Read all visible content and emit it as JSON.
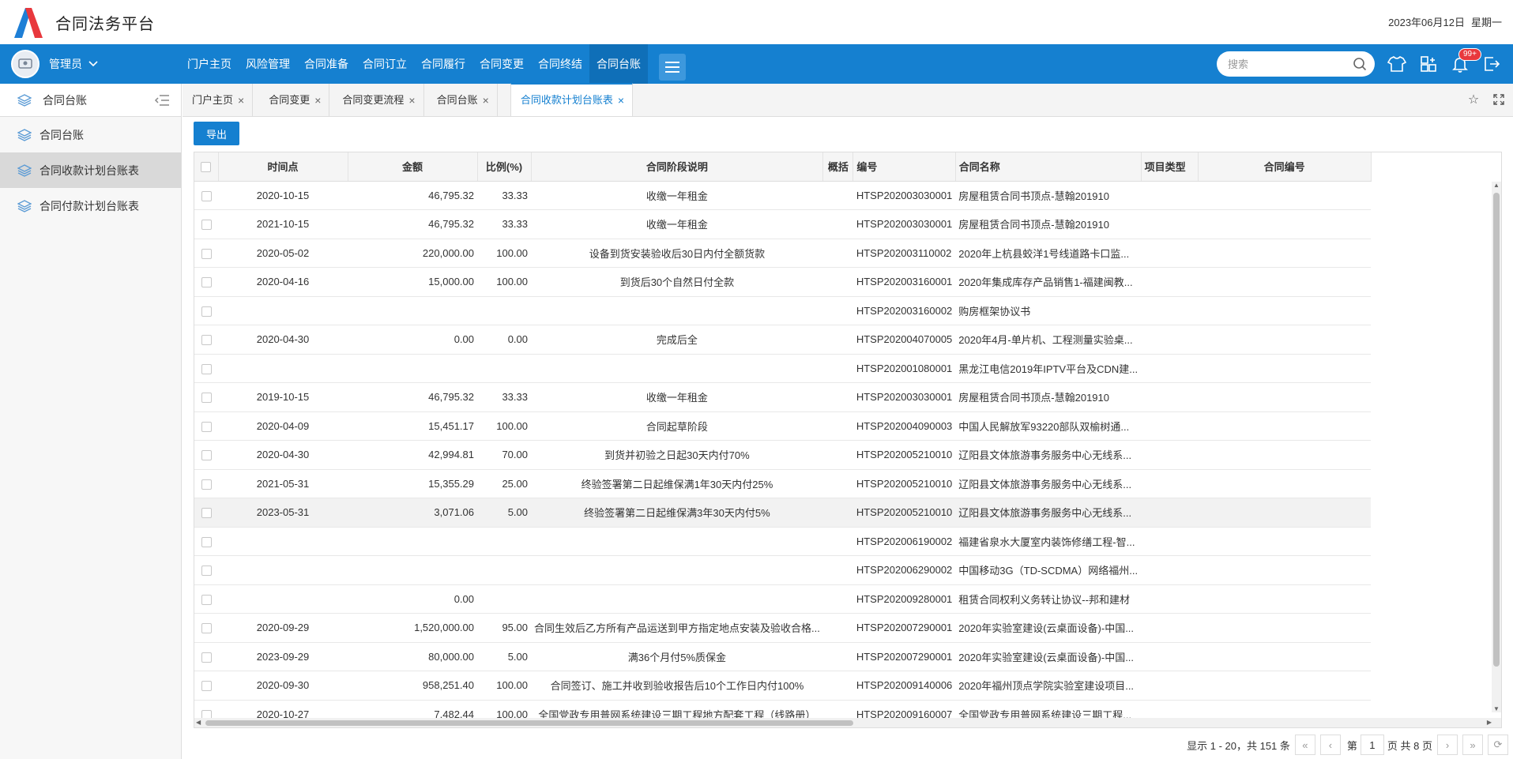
{
  "app": {
    "title": "合同法务平台",
    "date": "2023年06月12日",
    "weekday": "星期一"
  },
  "user": {
    "name": "管理员"
  },
  "nav": {
    "items": [
      "门户主页",
      "风险管理",
      "合同准备",
      "合同订立",
      "合同履行",
      "合同变更",
      "合同终结",
      "合同台账"
    ],
    "active": 7
  },
  "search": {
    "placeholder": "搜索"
  },
  "notifications": {
    "badge": "99+"
  },
  "sidebar": {
    "header": "合同台账",
    "items": [
      "合同台账",
      "合同收款计划台账表",
      "合同付款计划台账表"
    ],
    "active": 1
  },
  "tabs": [
    "门户主页",
    "合同变更",
    "合同变更流程",
    "合同台账",
    "合同收款计划台账表"
  ],
  "toolbar": {
    "export_label": "导出"
  },
  "table": {
    "columns": [
      "时间点",
      "金额",
      "比例(%)",
      "合同阶段说明",
      "概括",
      "编号",
      "合同名称",
      "项目类型",
      "合同编号"
    ],
    "rows": [
      [
        "2020-10-15",
        "46,795.32",
        "33.33",
        "收缴一年租金",
        "",
        "HTSP202003030001",
        "房屋租赁合同书顶点-慧翰201910",
        "",
        ""
      ],
      [
        "2021-10-15",
        "46,795.32",
        "33.33",
        "收缴一年租金",
        "",
        "HTSP202003030001",
        "房屋租赁合同书顶点-慧翰201910",
        "",
        ""
      ],
      [
        "2020-05-02",
        "220,000.00",
        "100.00",
        "设备到货安装验收后30日内付全额货款",
        "",
        "HTSP202003110002",
        "2020年上杭县蛟洋1号线道路卡口监...",
        "",
        ""
      ],
      [
        "2020-04-16",
        "15,000.00",
        "100.00",
        "到货后30个自然日付全款",
        "",
        "HTSP202003160001",
        "2020年集成库存产品销售1-福建闽教...",
        "",
        ""
      ],
      [
        "",
        "",
        "",
        "",
        "",
        "HTSP202003160002",
        "购房框架协议书",
        "",
        ""
      ],
      [
        "2020-04-30",
        "0.00",
        "0.00",
        "完成后全",
        "",
        "HTSP202004070005",
        "2020年4月-单片机、工程测量实验桌...",
        "",
        ""
      ],
      [
        "",
        "",
        "",
        "",
        "",
        "HTSP202001080001",
        "黑龙江电信2019年IPTV平台及CDN建...",
        "",
        ""
      ],
      [
        "2019-10-15",
        "46,795.32",
        "33.33",
        "收缴一年租金",
        "",
        "HTSP202003030001",
        "房屋租赁合同书顶点-慧翰201910",
        "",
        ""
      ],
      [
        "2020-04-09",
        "15,451.17",
        "100.00",
        "合同起草阶段",
        "",
        "HTSP202004090003",
        "中国人民解放军93220部队双榆树通...",
        "",
        ""
      ],
      [
        "2020-04-30",
        "42,994.81",
        "70.00",
        "到货并初验之日起30天内付70%",
        "",
        "HTSP202005210010",
        "辽阳县文体旅游事务服务中心无线系...",
        "",
        ""
      ],
      [
        "2021-05-31",
        "15,355.29",
        "25.00",
        "终验签署第二日起维保满1年30天内付25%",
        "",
        "HTSP202005210010",
        "辽阳县文体旅游事务服务中心无线系...",
        "",
        ""
      ],
      [
        "2023-05-31",
        "3,071.06",
        "5.00",
        "终验签署第二日起维保满3年30天内付5%",
        "",
        "HTSP202005210010",
        "辽阳县文体旅游事务服务中心无线系...",
        "",
        ""
      ],
      [
        "",
        "",
        "",
        "",
        "",
        "HTSP202006190002",
        "福建省泉水大厦室内装饰修缮工程-智...",
        "",
        ""
      ],
      [
        "",
        "",
        "",
        "",
        "",
        "HTSP202006290002",
        "中国移动3G（TD-SCDMA）网络福州...",
        "",
        ""
      ],
      [
        "",
        "0.00",
        "",
        "",
        "",
        "HTSP202009280001",
        "租赁合同权利义务转让协议--邦和建材",
        "",
        ""
      ],
      [
        "2020-09-29",
        "1,520,000.00",
        "95.00",
        "合同生效后乙方所有产品运送到甲方指定地点安装及验收合格...",
        "",
        "HTSP202007290001",
        "2020年实验室建设(云桌面设备)-中国...",
        "",
        ""
      ],
      [
        "2023-09-29",
        "80,000.00",
        "5.00",
        "满36个月付5%质保金",
        "",
        "HTSP202007290001",
        "2020年实验室建设(云桌面设备)-中国...",
        "",
        ""
      ],
      [
        "2020-09-30",
        "958,251.40",
        "100.00",
        "合同签订、施工并收到验收报告后10个工作日内付100%",
        "",
        "HTSP202009140006",
        "2020年福州顶点学院实验室建设项目...",
        "",
        ""
      ],
      [
        "2020-10-27",
        "7,482.44",
        "100.00",
        "全国党政专用普网系统建设三期工程地方配套工程（线路册）",
        "",
        "HTSP202009160007",
        "全国党政专用普网系统建设三期工程...",
        "",
        ""
      ]
    ],
    "highlighted_row": 11
  },
  "pager": {
    "summary": "显示 1 - 20，共 151 条",
    "page_prefix": "第",
    "current_page": "1",
    "page_suffix": "页 共 8 页"
  }
}
